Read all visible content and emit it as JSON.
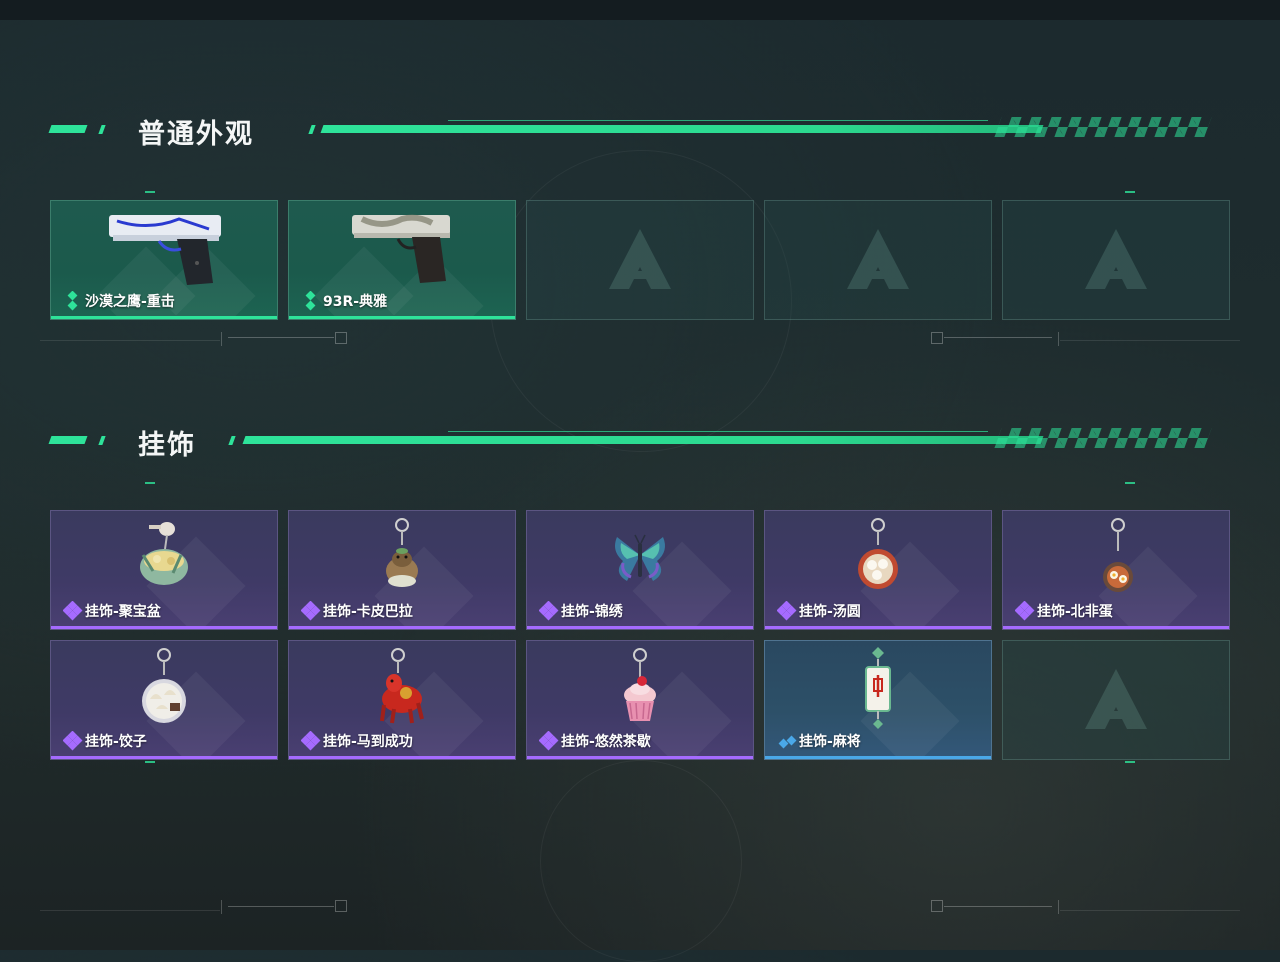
{
  "sections": [
    {
      "title": "普通外观",
      "items": [
        {
          "name": "沙漠之鹰-重击",
          "rarity": "green",
          "icon": "pistol-desert-eagle-icon"
        },
        {
          "name": "93R-典雅",
          "rarity": "green",
          "icon": "pistol-93r-icon"
        },
        {
          "name": "",
          "rarity": "empty",
          "icon": "placeholder-logo-icon"
        },
        {
          "name": "",
          "rarity": "empty",
          "icon": "placeholder-logo-icon"
        },
        {
          "name": "",
          "rarity": "empty",
          "icon": "placeholder-logo-icon"
        }
      ]
    },
    {
      "title": "挂饰",
      "items": [
        {
          "name": "挂饰-聚宝盆",
          "rarity": "purple",
          "icon": "charm-treasure-bowl-icon"
        },
        {
          "name": "挂饰-卡皮巴拉",
          "rarity": "purple",
          "icon": "charm-capybara-icon"
        },
        {
          "name": "挂饰-锦绣",
          "rarity": "purple",
          "icon": "charm-butterfly-icon"
        },
        {
          "name": "挂饰-汤圆",
          "rarity": "purple",
          "icon": "charm-tangyuan-icon"
        },
        {
          "name": "挂饰-北非蛋",
          "rarity": "purple",
          "icon": "charm-shakshuka-icon"
        },
        {
          "name": "挂饰-饺子",
          "rarity": "purple",
          "icon": "charm-dumplings-icon"
        },
        {
          "name": "挂饰-马到成功",
          "rarity": "purple",
          "icon": "charm-horse-icon"
        },
        {
          "name": "挂饰-悠然茶歇",
          "rarity": "purple",
          "icon": "charm-cupcake-icon"
        },
        {
          "name": "挂饰-麻将",
          "rarity": "blue",
          "icon": "charm-mahjong-icon"
        },
        {
          "name": "",
          "rarity": "empty",
          "icon": "placeholder-logo-icon"
        }
      ]
    }
  ],
  "colors": {
    "accent": "#2ee39a",
    "rarity_green": "#2ee39a",
    "rarity_purple": "#a56bff",
    "rarity_blue": "#4aa8e8"
  }
}
